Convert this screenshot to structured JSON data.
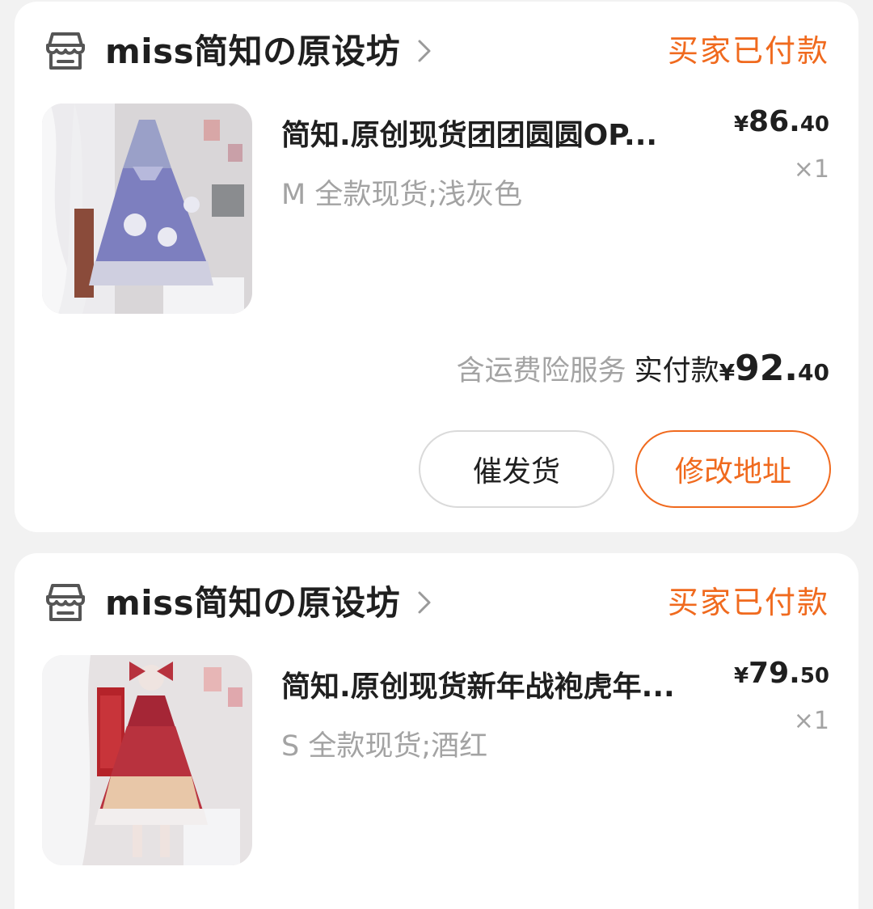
{
  "colors": {
    "accent": "#f06a1e",
    "text": "#1f1f1f",
    "muted": "#a3a3a3",
    "background": "#f2f2f2"
  },
  "orders": [
    {
      "store_icon": "store-icon",
      "store_name": "miss简知の原设坊",
      "status": "买家已付款",
      "product": {
        "title": "简知.原创现货团团圆圆OP...",
        "sku": "M 全款现货;浅灰色",
        "price_currency": "¥",
        "price_int": "86.",
        "price_dec": "40",
        "quantity": "×1"
      },
      "summary": {
        "service_note": "含运费险服务",
        "paid_label": "实付款",
        "paid_currency": "¥",
        "paid_int": "92.",
        "paid_dec": "40"
      },
      "buttons": {
        "urge": "催发货",
        "change_address": "修改地址"
      }
    },
    {
      "store_icon": "store-icon",
      "store_name": "miss简知の原设坊",
      "status": "买家已付款",
      "product": {
        "title": "简知.原创现货新年战袍虎年...",
        "sku": "S 全款现货;酒红",
        "price_currency": "¥",
        "price_int": "79.",
        "price_dec": "50",
        "quantity": "×1"
      }
    }
  ]
}
